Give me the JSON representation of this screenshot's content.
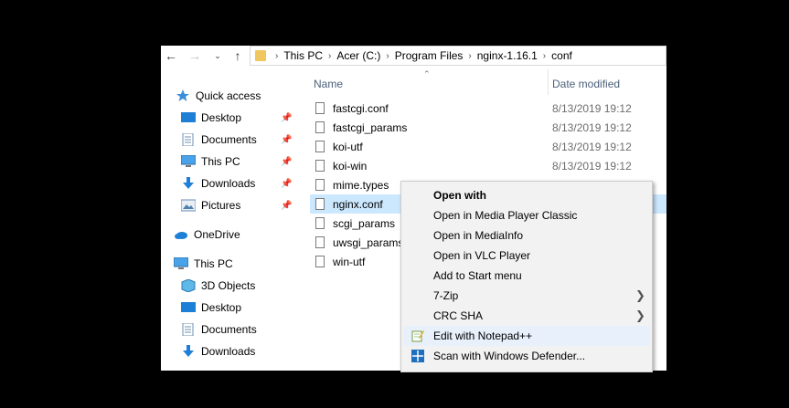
{
  "address_bar": {
    "crumbs": [
      "This PC",
      "Acer (C:)",
      "Program Files",
      "nginx-1.16.1",
      "conf"
    ]
  },
  "nav_pane": {
    "items": [
      {
        "label": "Quick access",
        "icon": "star-icon"
      },
      {
        "label": "Desktop",
        "icon": "desktop-icon",
        "pinned": true
      },
      {
        "label": "Documents",
        "icon": "documents-icon",
        "pinned": true
      },
      {
        "label": "This PC",
        "icon": "computer-icon",
        "pinned": true
      },
      {
        "label": "Downloads",
        "icon": "download-icon",
        "pinned": true
      },
      {
        "label": "Pictures",
        "icon": "pictures-icon",
        "pinned": true
      },
      {
        "label": "OneDrive",
        "icon": "cloud-icon"
      },
      {
        "label": "This PC",
        "icon": "computer-icon"
      },
      {
        "label": "3D Objects",
        "icon": "cube-icon"
      },
      {
        "label": "Desktop",
        "icon": "desktop-icon"
      },
      {
        "label": "Documents",
        "icon": "documents-icon"
      },
      {
        "label": "Downloads",
        "icon": "download-icon"
      }
    ]
  },
  "file_list": {
    "columns": {
      "name": "Name",
      "date": "Date modified"
    },
    "files": [
      {
        "name": "fastcgi.conf",
        "date": "8/13/2019 19:12"
      },
      {
        "name": "fastcgi_params",
        "date": "8/13/2019 19:12"
      },
      {
        "name": "koi-utf",
        "date": "8/13/2019 19:12"
      },
      {
        "name": "koi-win",
        "date": "8/13/2019 19:12"
      },
      {
        "name": "mime.types",
        "date": ""
      },
      {
        "name": "nginx.conf",
        "date": "",
        "selected": true
      },
      {
        "name": "scgi_params",
        "date": ""
      },
      {
        "name": "uwsgi_params",
        "date": ""
      },
      {
        "name": "win-utf",
        "date": ""
      }
    ]
  },
  "context_menu": {
    "items": [
      {
        "label": "Open with",
        "bold": true
      },
      {
        "label": "Open in Media Player Classic"
      },
      {
        "label": "Open in MediaInfo"
      },
      {
        "label": "Open in VLC Player"
      },
      {
        "label": "Add to Start menu"
      },
      {
        "label": "7-Zip",
        "submenu": true
      },
      {
        "label": "CRC SHA",
        "submenu": true
      },
      {
        "label": "Edit with Notepad++",
        "icon": "notepad-plus-plus-icon",
        "highlighted": true
      },
      {
        "label": "Scan with Windows Defender...",
        "icon": "windows-defender-icon"
      }
    ]
  },
  "colors": {
    "selection": "#cce8ff",
    "header_text": "#4c607a",
    "menu_bg": "#f2f2f2",
    "folder_yellow": "#f0c75e",
    "accent_blue": "#1e7fd6"
  }
}
